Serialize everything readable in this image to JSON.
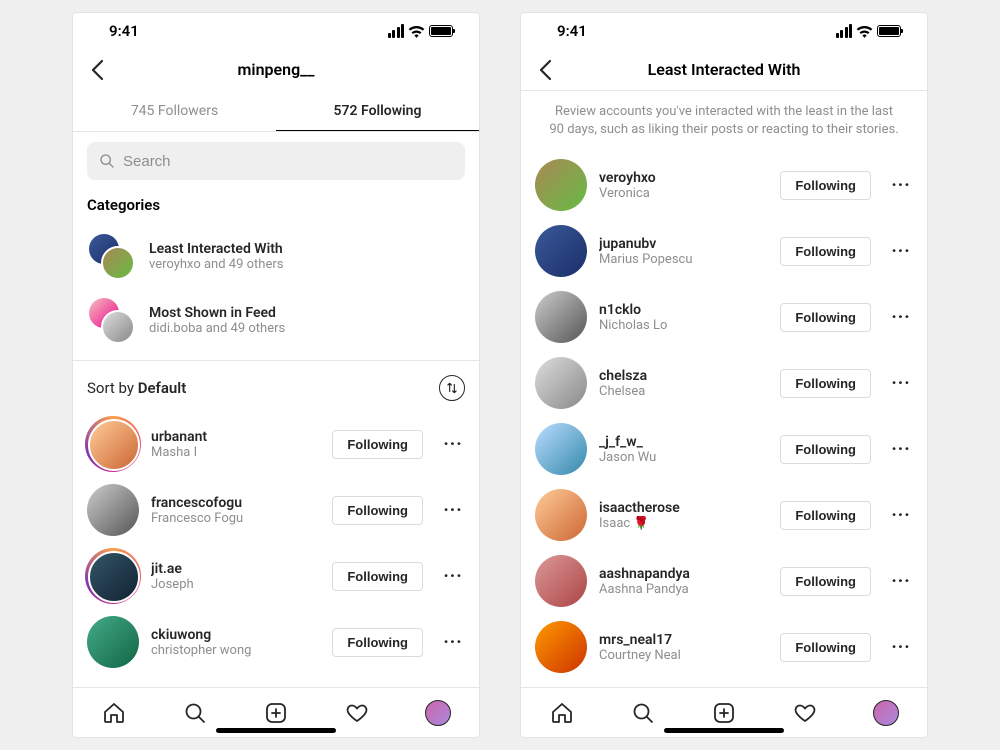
{
  "status": {
    "time": "9:41"
  },
  "left": {
    "header_title": "minpeng__",
    "tabs": {
      "followers": "745 Followers",
      "following": "572 Following",
      "active": "following"
    },
    "search_placeholder": "Search",
    "categories_heading": "Categories",
    "categories": [
      {
        "title": "Least Interacted With",
        "subtitle": "veroyhxo and 49 others"
      },
      {
        "title": "Most Shown in Feed",
        "subtitle": "didi.boba and 49 others"
      }
    ],
    "sort_label_prefix": "Sort by ",
    "sort_value": "Default",
    "following_button_label": "Following",
    "users": [
      {
        "username": "urbanant",
        "name": "Masha I",
        "ring": true
      },
      {
        "username": "francescofogu",
        "name": "Francesco Fogu",
        "ring": false
      },
      {
        "username": "jit.ae",
        "name": "Joseph",
        "ring": true
      },
      {
        "username": "ckiuwong",
        "name": "christopher wong",
        "ring": false
      }
    ]
  },
  "right": {
    "header_title": "Least Interacted With",
    "description": "Review accounts you've interacted with the least in the last 90 days, such as liking their posts or reacting to their stories.",
    "following_button_label": "Following",
    "users": [
      {
        "username": "veroyhxo",
        "name": "Veronica"
      },
      {
        "username": "jupanubv",
        "name": "Marius Popescu"
      },
      {
        "username": "n1cklo",
        "name": "Nicholas Lo"
      },
      {
        "username": "chelsza",
        "name": "Chelsea"
      },
      {
        "username": "_j_f_w_",
        "name": "Jason Wu"
      },
      {
        "username": "isaactherose",
        "name": "Isaac 🌹"
      },
      {
        "username": "aashnapandya",
        "name": "Aashna Pandya"
      },
      {
        "username": "mrs_neal17",
        "name": "Courtney Neal"
      }
    ]
  }
}
